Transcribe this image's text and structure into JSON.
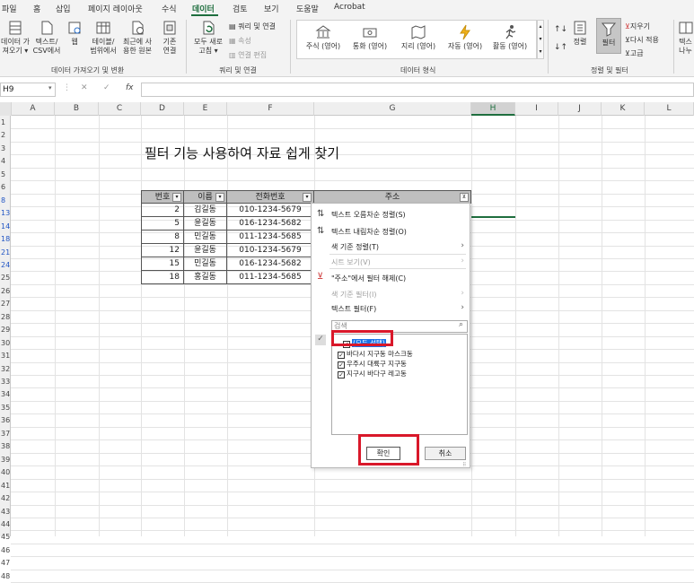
{
  "tabs": [
    "파일",
    "홈",
    "삽입",
    "페이지 레이아웃",
    "수식",
    "데이터",
    "검토",
    "보기",
    "도움말",
    "Acrobat"
  ],
  "active_tab": "데이터",
  "ribbon": {
    "get_data": {
      "btn1": "데이터 가\n져오기 ▾",
      "btn2": "텍스트/\nCSV에서",
      "btn3": "웹",
      "btn4": "테이블/\n범위에서",
      "btn5": "최근에 사\n용한 원본",
      "btn6": "기존\n연결",
      "label": "데이터 가져오기 및 변환"
    },
    "queries": {
      "refresh": "모두 새로\n고침 ▾",
      "queries_conn": "쿼리 및 연결",
      "properties": "속성",
      "edit_links": "연결 편집",
      "label": "쿼리 및 연결"
    },
    "data_types": {
      "stocks": "주식 (영어)",
      "currency": "통화 (영어)",
      "geography": "지리 (영어)",
      "automotive": "자동 (영어)",
      "activity": "활동 (영어)",
      "label": "데이터 형식"
    },
    "sort_filter": {
      "sort": "정렬",
      "filter": "필터",
      "clear": "지우기",
      "reapply": "다시 적용",
      "advanced": "고급",
      "label": "정렬 및 필터",
      "text_to_col": "텍스\n나누"
    }
  },
  "namebox": "H9",
  "columns": [
    "A",
    "B",
    "C",
    "D",
    "E",
    "F",
    "G",
    "H",
    "I",
    "J",
    "K",
    "L"
  ],
  "rows": [
    "1",
    "2",
    "3",
    "4",
    "5",
    "6",
    "8",
    "13",
    "14",
    "18",
    "21",
    "24",
    "25",
    "26",
    "27",
    "28",
    "29",
    "30",
    "31",
    "32",
    "33",
    "34",
    "35",
    "36",
    "37",
    "38",
    "39",
    "40",
    "41",
    "42",
    "43",
    "44",
    "45",
    "46",
    "47",
    "48"
  ],
  "title": "필터 기능 사용하여 자료 쉽게 찾기",
  "table": {
    "headers": [
      "번호",
      "이름",
      "전화번호",
      "주소"
    ],
    "rows": [
      [
        "2",
        "김길동",
        "010-1234-5679"
      ],
      [
        "5",
        "윤길동",
        "016-1234-5682"
      ],
      [
        "8",
        "민길동",
        "011-1234-5685"
      ],
      [
        "12",
        "윤길동",
        "010-1234-5679"
      ],
      [
        "15",
        "민길동",
        "016-1234-5682"
      ],
      [
        "18",
        "홍길동",
        "011-1234-5685"
      ]
    ]
  },
  "filter_menu": {
    "sort_asc": "텍스트 오름차순 정렬(S)",
    "sort_desc": "텍스트 내림차순 정렬(O)",
    "sort_color": "색 기준 정렬(T)",
    "sheet_view": "시트 보기(V)",
    "clear_filter": "\"주소\"에서 필터 해제(C)",
    "filter_color": "색 기준 필터(I)",
    "text_filter": "텍스트 필터(F)",
    "search_placeholder": "검색",
    "items": [
      "(모두 선택)",
      "바다시 지구동 마스크동",
      "우주시 대륙구 지구동",
      "지구시 바다구 레고동"
    ],
    "ok": "확인",
    "cancel": "취소"
  },
  "colors": {
    "accent": "#1e6e3e",
    "highlight": "#d9182a",
    "select_blue": "#1a73e8"
  }
}
